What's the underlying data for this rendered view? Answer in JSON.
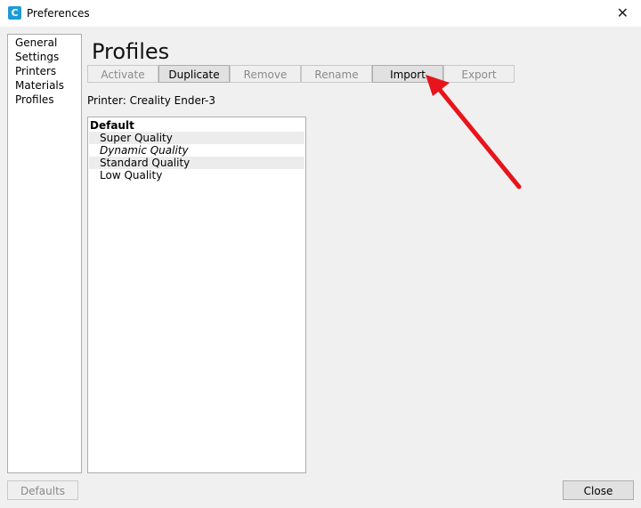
{
  "window": {
    "title": "Preferences",
    "app_icon_glyph": "C",
    "close_glyph": "✕"
  },
  "sidebar": {
    "items": [
      {
        "label": "General"
      },
      {
        "label": "Settings"
      },
      {
        "label": "Printers"
      },
      {
        "label": "Materials"
      },
      {
        "label": "Profiles"
      }
    ]
  },
  "main": {
    "title": "Profiles",
    "toolbar": {
      "activate": "Activate",
      "duplicate": "Duplicate",
      "remove": "Remove",
      "rename": "Rename",
      "import": "Import",
      "export": "Export"
    },
    "printer_label": "Printer: Creality Ender-3",
    "profile_list": {
      "group": "Default",
      "items": [
        {
          "label": "Super Quality"
        },
        {
          "label": "Dynamic Quality"
        },
        {
          "label": "Standard Quality"
        },
        {
          "label": "Low Quality"
        }
      ]
    }
  },
  "footer": {
    "defaults": "Defaults",
    "close": "Close"
  },
  "colors": {
    "accent_arrow": "#e8141c",
    "app_icon": "#1d9bd7"
  }
}
